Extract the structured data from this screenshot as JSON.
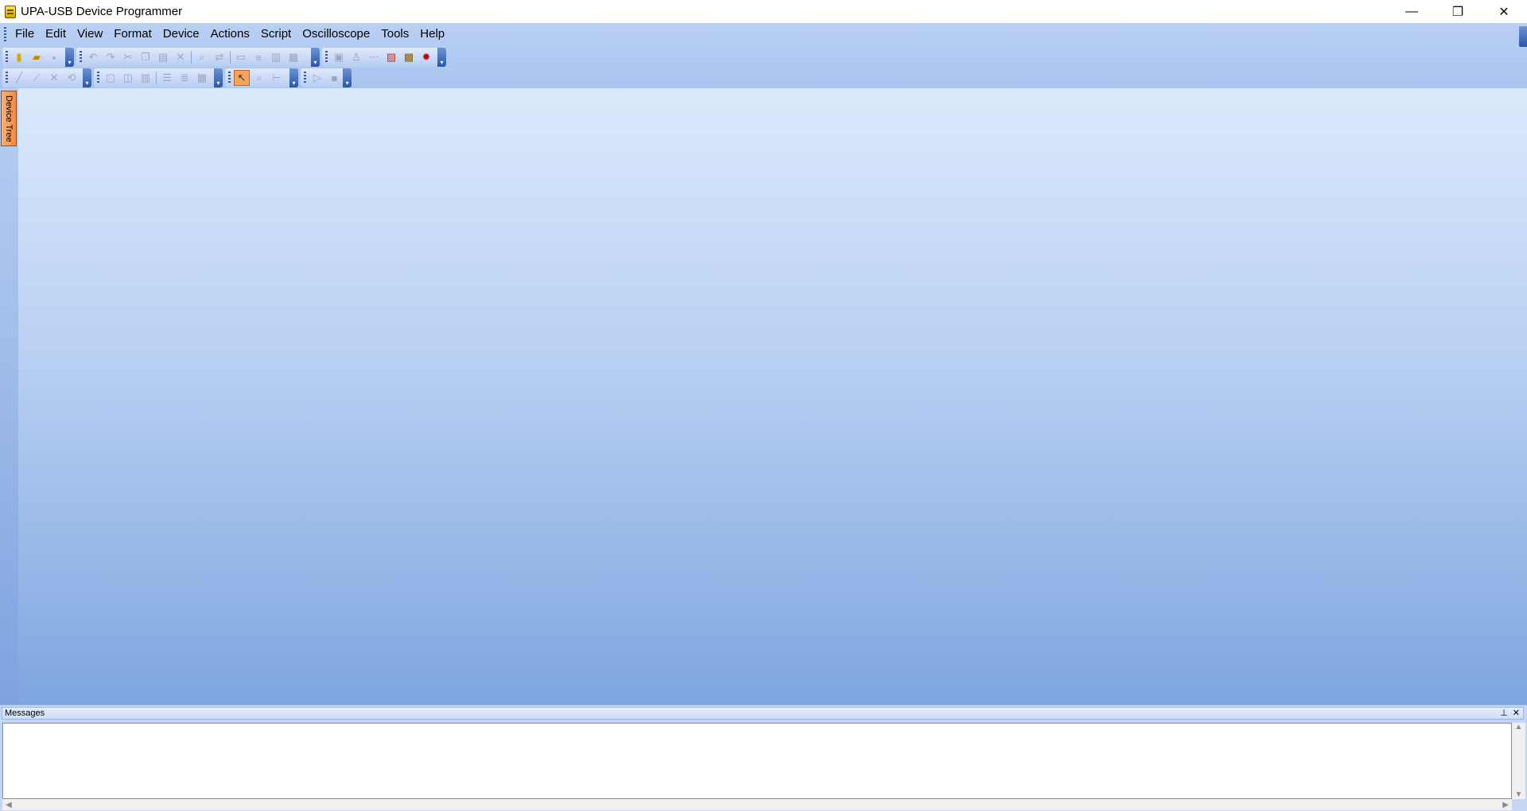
{
  "window": {
    "title": "UPA-USB Device Programmer",
    "controls": {
      "minimize": "—",
      "restore": "❐",
      "close": "✕"
    }
  },
  "menu": [
    "File",
    "Edit",
    "View",
    "Format",
    "Device",
    "Actions",
    "Script",
    "Oscilloscope",
    "Tools",
    "Help"
  ],
  "toolbars": {
    "file_tools": [
      "new-icon",
      "open-icon",
      "save-icon"
    ],
    "edit_tools": [
      "undo-icon",
      "redo-icon",
      "cut-icon",
      "copy-icon",
      "paste-icon",
      "delete-icon",
      "find-icon",
      "replace-icon",
      "select-all-icon",
      "fill-icon",
      "compare-icon",
      "checksum-icon"
    ],
    "device_tools": [
      "read-icon",
      "write-icon",
      "verify-icon",
      "erase-icon",
      "program-icon",
      "debug-icon"
    ],
    "draw_tools": [
      "line-icon",
      "wire-icon",
      "scale-icon",
      "rotate-icon"
    ],
    "view_tools": [
      "view1-icon",
      "view2-icon",
      "view3-icon",
      "list1-icon",
      "list2-icon",
      "grid-icon"
    ],
    "pointer_tools": [
      "pointer-icon",
      "zoom-icon",
      "measure-icon"
    ],
    "run_tools": [
      "run-icon",
      "stop-icon"
    ]
  },
  "dock": {
    "device_tree_tab": "Device Tree"
  },
  "messages_panel": {
    "title": "Messages",
    "pin": "⊥",
    "close": "✕"
  },
  "colors": {
    "selected_tool": "#f8a25a",
    "mdi_top": "#dce9fc",
    "mdi_bottom": "#7fa6e0"
  }
}
